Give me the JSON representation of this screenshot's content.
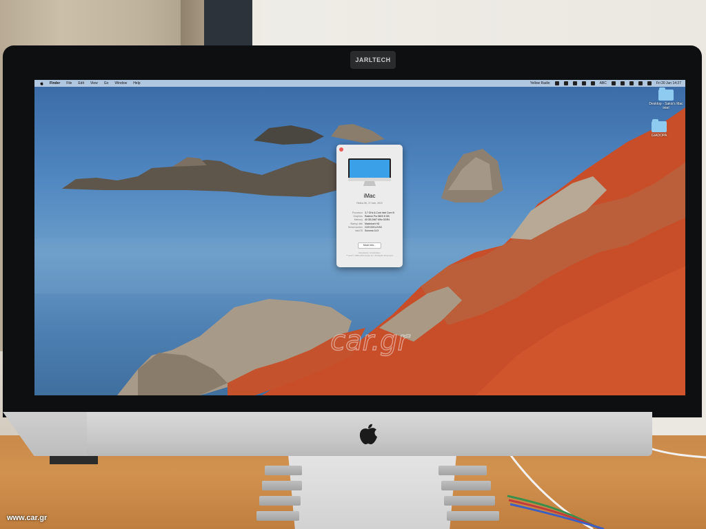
{
  "camera_label": "JARLTECH",
  "menubar": {
    "items": [
      "Finder",
      "File",
      "Edit",
      "View",
      "Go",
      "Window",
      "Help"
    ],
    "right_text": "Yellow Radio",
    "input_source": "ABC",
    "clock": "Fri 20 Jun 14:27"
  },
  "desktop_items": [
    {
      "label": "Desktop - Sakis's Mac intel",
      "icon": "folder-icon"
    },
    {
      "label": "GIADOPA",
      "icon": "folder-icon"
    }
  ],
  "about_window": {
    "title": "iMac",
    "subtitle": "Retina 5K, 27-inch, 2019",
    "specs": [
      {
        "key": "Processor",
        "value": "3,7 GHz 6-Core Intel Core i5"
      },
      {
        "key": "Graphics",
        "value": "Radeon Pro 580X 8 GB"
      },
      {
        "key": "Memory",
        "value": "40 GB 2667 MHz DDR4"
      },
      {
        "key": "Startup disk",
        "value": "Macintosh HD"
      },
      {
        "key": "Serial number",
        "value": "C02YZ2KLJV3G"
      },
      {
        "key": "macOS",
        "value": "Sonoma 14.5"
      }
    ],
    "more_info_label": "More Info...",
    "regulatory": "Regulatory Certification",
    "copyright": "™ and © 1983-2024 Apple Inc. All Rights Reserved."
  },
  "watermark": "car.gr",
  "site_mark": "www.car.gr",
  "colors": {
    "screen_sea": "#4f86c0",
    "hillside": "#c9502a",
    "folder": "#8fcbf0",
    "close_button": "#ef5a56"
  }
}
